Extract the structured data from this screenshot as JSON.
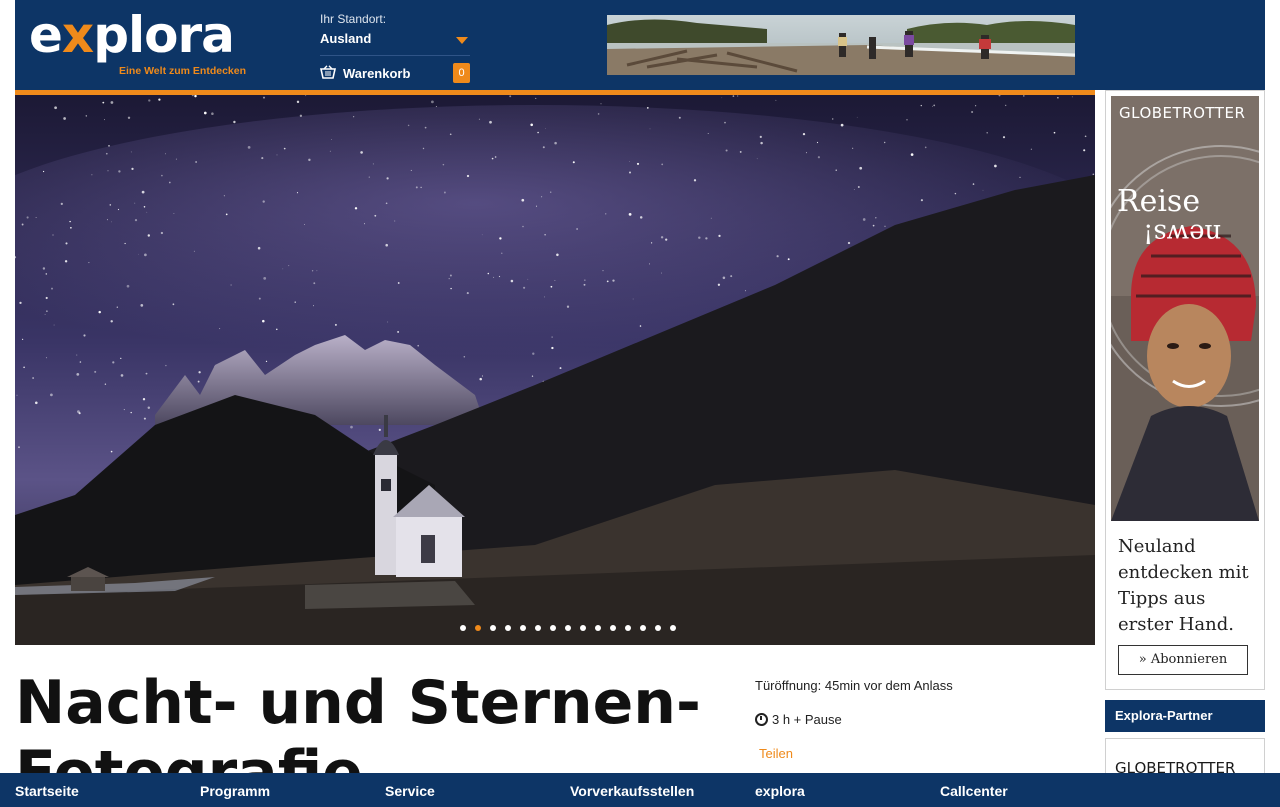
{
  "header": {
    "logo": {
      "word_start": "e",
      "word_x": "x",
      "word_end": "plora",
      "tagline": "Eine Welt zum Entdecken"
    },
    "location": {
      "label": "Ihr Standort:",
      "value": "Ausland"
    },
    "cart": {
      "label": "Warenkorb",
      "count": "0"
    }
  },
  "hero": {
    "slide_count": 15,
    "active_slide": 1
  },
  "event": {
    "title": "Nacht- und Sternen-Fotografie",
    "door_opening": "Türöffnung: 45min vor dem Anlass",
    "duration": "3 h + Pause",
    "share_label": "Teilen"
  },
  "sidebar_ad": {
    "brand": "GLOBETROTTER",
    "headline_1": "Reise",
    "headline_2": "news!",
    "copy": "Neuland entdecken mit Tipps aus erster Hand.",
    "button": "» Abonnieren"
  },
  "partner": {
    "heading": "Explora-Partner",
    "logo_text": "GLOBETROTTER"
  },
  "bottom_nav": {
    "items": [
      "Startseite",
      "Programm",
      "Service",
      "Vorverkaufsstellen",
      "explora",
      "Callcenter"
    ]
  },
  "colors": {
    "brand_blue": "#0d3566",
    "accent_orange": "#ef8a1b"
  }
}
